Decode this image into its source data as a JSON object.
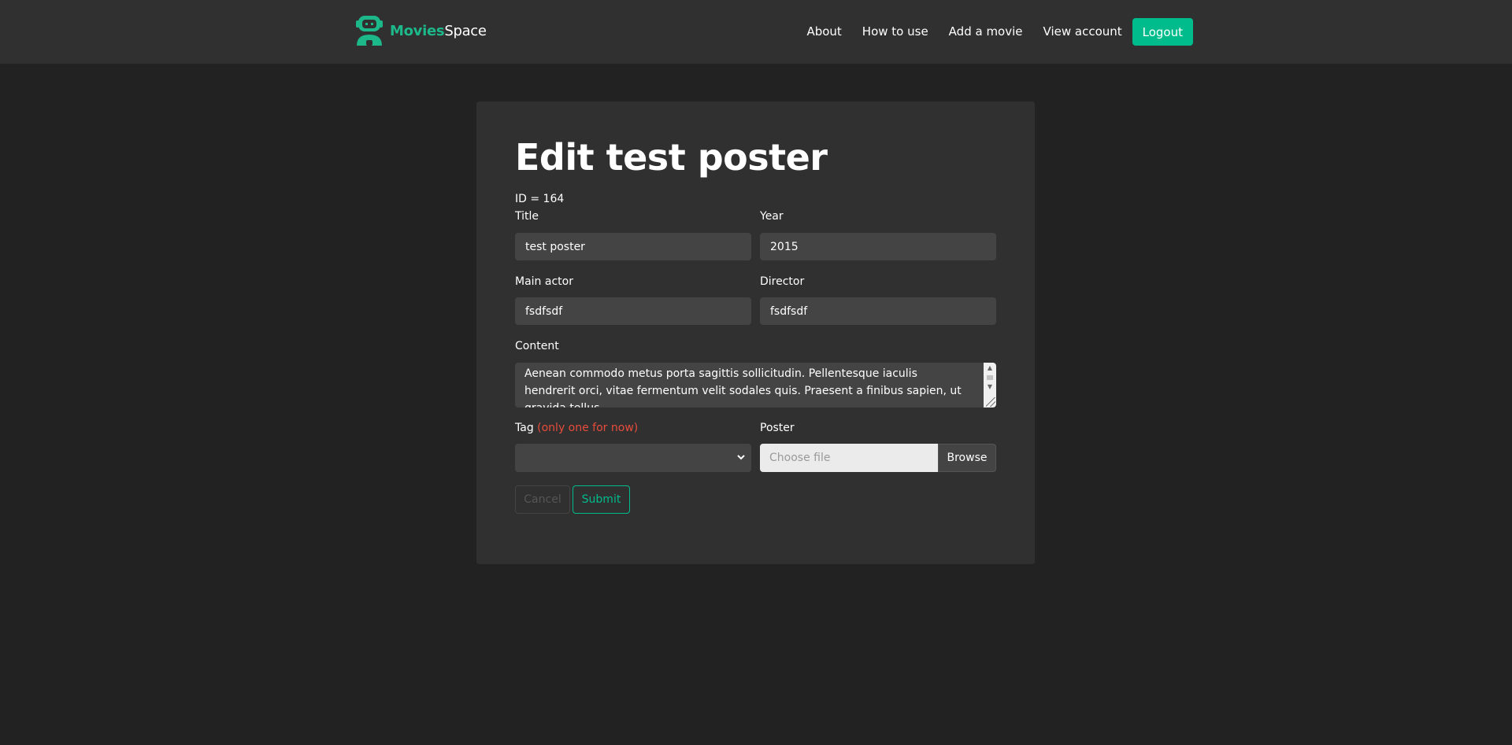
{
  "colors": {
    "accent": "#00bc8c",
    "background": "#222222",
    "navbar": "#303030",
    "card": "#303030",
    "input": "#444444",
    "hint": "#e74c3c"
  },
  "brand": {
    "icon": "robot-logo-icon",
    "name_strong": "Movies",
    "name_light": "Space"
  },
  "nav": {
    "links": [
      "About",
      "How to use",
      "Add a movie",
      "View account"
    ],
    "logout_label": "Logout"
  },
  "form": {
    "heading": "Edit test poster",
    "id_line": "ID = 164",
    "title_label": "Title",
    "title_value": "test poster",
    "year_label": "Year",
    "year_value": "2015",
    "actor_label": "Main actor",
    "actor_value": "fsdfsdf",
    "director_label": "Director",
    "director_value": "fsdfsdf",
    "content_label": "Content",
    "content_value": "Aenean commodo metus porta sagittis sollicitudin. Pellentesque iaculis hendrerit orci, vitae fermentum velit sodales quis. Praesent a finibus sapien, ut gravida tellus.",
    "tag_label": "Tag",
    "tag_hint": "(only one for now)",
    "tag_selected": "",
    "poster_label": "Poster",
    "file_placeholder": "Choose file",
    "browse_label": "Browse",
    "cancel_label": "Cancel",
    "submit_label": "Submit"
  }
}
